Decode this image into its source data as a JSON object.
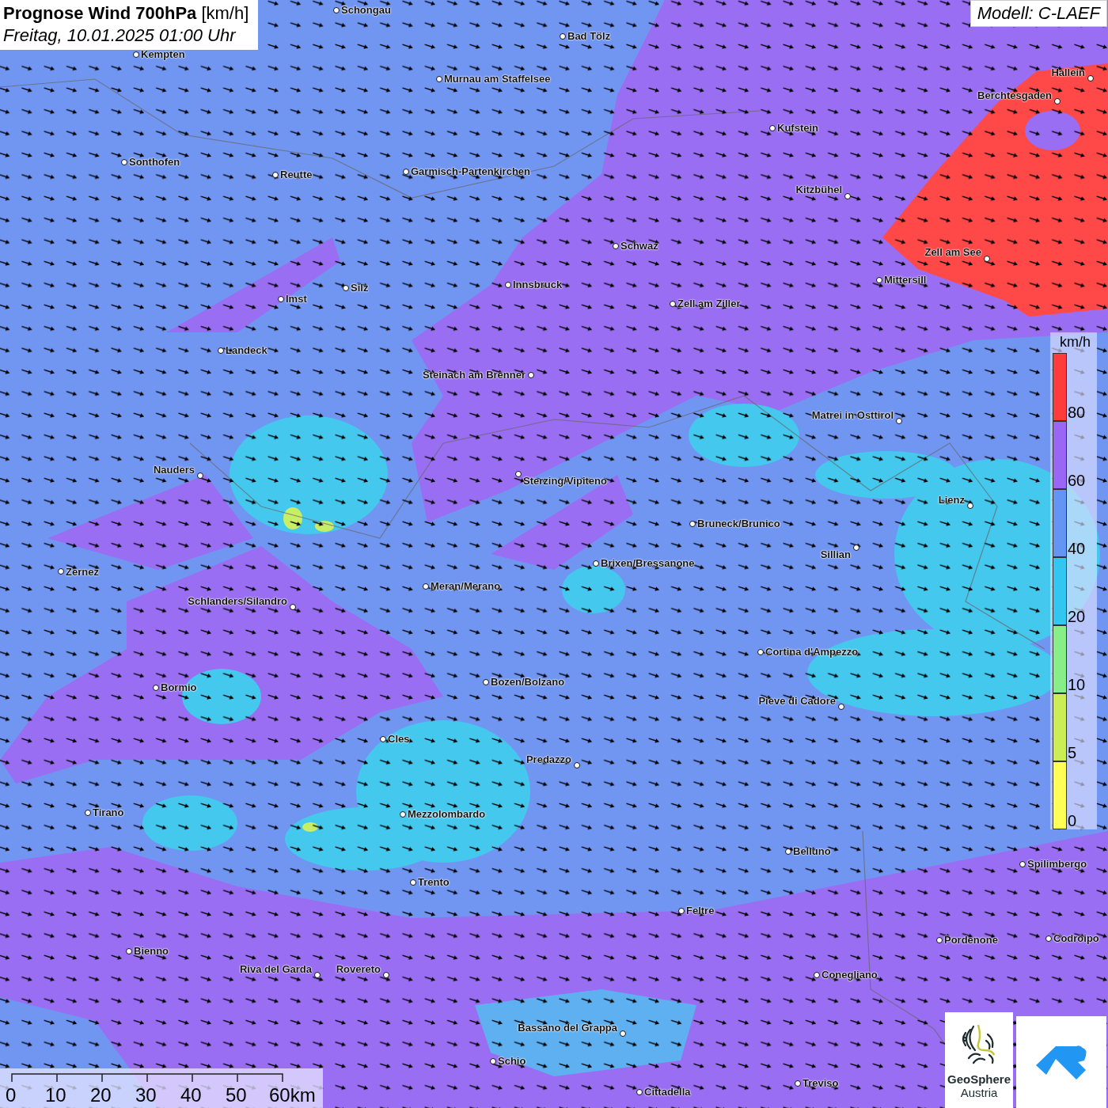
{
  "header": {
    "title": "**Prognose Wind 700hPa** [km/h]",
    "subtitle": "Freitag, 10.01.2025 01:00 Uhr"
  },
  "model": "Modell: C-LAEF",
  "cities": [
    {
      "name": "Schongau"
    },
    {
      "name": "Bad Tölz"
    },
    {
      "name": "Kempten"
    },
    {
      "name": "Murnau am Staffelsee"
    },
    {
      "name": "Hallein"
    },
    {
      "name": "Berchtesgaden"
    },
    {
      "name": "Kufstein"
    },
    {
      "name": "Sonthofen"
    },
    {
      "name": "Reutte"
    },
    {
      "name": "Garmisch-Partenkirchen"
    },
    {
      "name": "Kitzbühel"
    },
    {
      "name": "Schwaz"
    },
    {
      "name": "Zell am See"
    },
    {
      "name": "Mittersill"
    },
    {
      "name": "Innsbruck"
    },
    {
      "name": "Silz"
    },
    {
      "name": "Imst"
    },
    {
      "name": "Zell am Ziller"
    },
    {
      "name": "Landeck"
    },
    {
      "name": "Steinach am Brenner"
    },
    {
      "name": "Matrei in Osttirol"
    },
    {
      "name": "Nauders"
    },
    {
      "name": "Sterzing/Vipiteno"
    },
    {
      "name": "Lienz"
    },
    {
      "name": "Bruneck/Brunico"
    },
    {
      "name": "Sillian"
    },
    {
      "name": "Zernez"
    },
    {
      "name": "Brixen/Bressanone"
    },
    {
      "name": "Meran/Merano"
    },
    {
      "name": "Schlanders/Silandro"
    },
    {
      "name": "Cortina d'Ampezzo"
    },
    {
      "name": "Bozen/Bolzano"
    },
    {
      "name": "Bormio"
    },
    {
      "name": "Pieve di Cadore"
    },
    {
      "name": "Cles"
    },
    {
      "name": "Predazzo"
    },
    {
      "name": "Tirano"
    },
    {
      "name": "Mezzolombardo"
    },
    {
      "name": "Belluno"
    },
    {
      "name": "Spilimbergo"
    },
    {
      "name": "Trento"
    },
    {
      "name": "Feltre"
    },
    {
      "name": "Pordenone"
    },
    {
      "name": "Codroipo"
    },
    {
      "name": "Bienno"
    },
    {
      "name": "Riva del Garda"
    },
    {
      "name": "Rovereto"
    },
    {
      "name": "Conegliano"
    },
    {
      "name": "Bassano del Grappa"
    },
    {
      "name": "Schio"
    },
    {
      "name": "Treviso"
    },
    {
      "name": "Cittadella"
    }
  ],
  "legend": {
    "unit": "km/h",
    "classes": [
      {
        "label": "80",
        "color": "#ff3b3b"
      },
      {
        "label": "60",
        "color": "#9966f5"
      },
      {
        "label": "40",
        "color": "#6495f5"
      },
      {
        "label": "20",
        "color": "#33c6f0"
      },
      {
        "label": "10",
        "color": "#88ee88"
      },
      {
        "label": "5",
        "color": "#ccee55"
      },
      {
        "label": "0",
        "color": "#ffff55"
      }
    ]
  },
  "scale_bar": {
    "ticks": [
      "0",
      "10",
      "20",
      "30",
      "40",
      "50",
      "60km"
    ]
  },
  "logos": {
    "name_line_1": "GeoSphere",
    "name_line_2": "Austria"
  }
}
